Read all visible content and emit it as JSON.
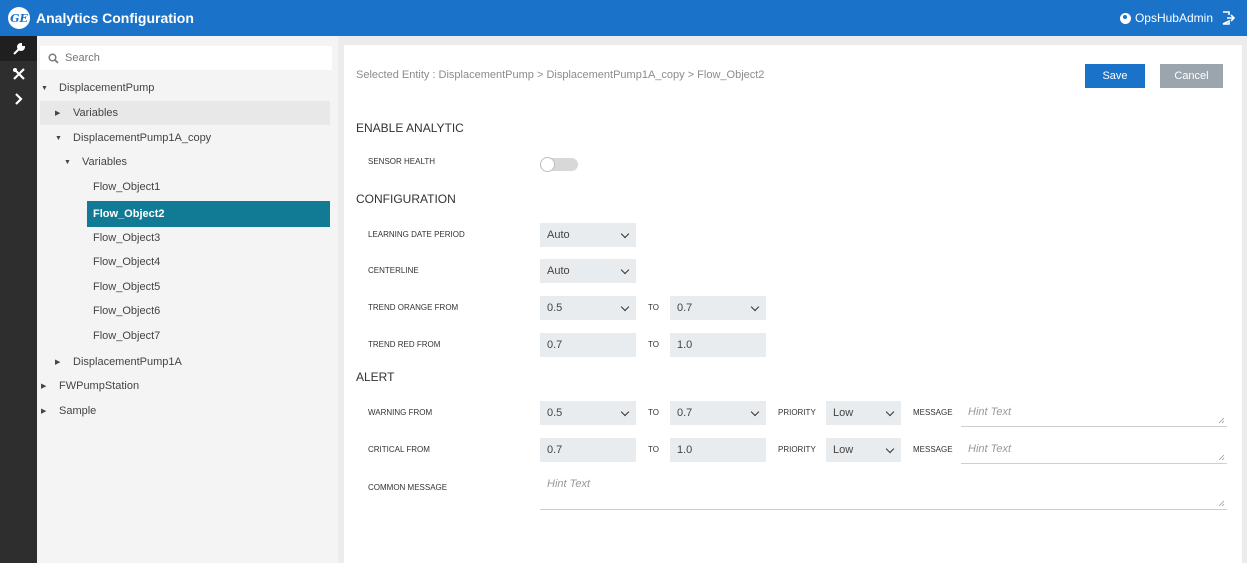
{
  "header": {
    "logo_text": "GE",
    "title": "Analytics Configuration",
    "user": "OpsHubAdmin"
  },
  "rail": {
    "icons": [
      "wrench-icon",
      "tools-icon",
      "chevron-right-icon"
    ]
  },
  "tree": {
    "search_placeholder": "Search",
    "items": [
      {
        "label": "DisplacementPump",
        "caret": "down"
      },
      {
        "label": "Variables",
        "caret": "right"
      },
      {
        "label": "DisplacementPump1A_copy",
        "caret": "down"
      },
      {
        "label": "Variables",
        "caret": "down"
      },
      {
        "label": "Flow_Object1",
        "caret": ""
      },
      {
        "label": "Flow_Object2",
        "caret": ""
      },
      {
        "label": "Flow_Object3",
        "caret": ""
      },
      {
        "label": "Flow_Object4",
        "caret": ""
      },
      {
        "label": "Flow_Object5",
        "caret": ""
      },
      {
        "label": "Flow_Object6",
        "caret": ""
      },
      {
        "label": "Flow_Object7",
        "caret": ""
      },
      {
        "label": "DisplacementPump1A",
        "caret": "right"
      },
      {
        "label": "FWPumpStation",
        "caret": "right"
      },
      {
        "label": "Sample",
        "caret": "right"
      }
    ],
    "selected_index": 5
  },
  "main": {
    "breadcrumb": "Selected Entity : DisplacementPump > DisplacementPump1A_copy > Flow_Object2",
    "save_label": "Save",
    "cancel_label": "Cancel",
    "enable_section": "ENABLE ANALYTIC",
    "sensor_health_label": "SENSOR HEALTH",
    "sensor_health_on": false,
    "config_section": "CONFIGURATION",
    "learning_label": "LEARNING DATE PERIOD",
    "learning_value": "Auto",
    "centerline_label": "CENTERLINE",
    "centerline_value": "Auto",
    "trend_orange_label": "TREND ORANGE FROM",
    "trend_orange_from": "0.5",
    "trend_orange_to": "0.7",
    "trend_red_label": "TREND RED FROM",
    "trend_red_from": "0.7",
    "trend_red_to": "1.0",
    "to_label": "TO",
    "alert_section": "ALERT",
    "warning_label": "WARNING FROM",
    "warning_from": "0.5",
    "warning_to": "0.7",
    "priority_label": "PRIORITY",
    "warning_priority": "Low",
    "message_label": "MESSAGE",
    "hint_text": "Hint Text",
    "critical_label": "CRITICAL FROM",
    "critical_from": "0.7",
    "critical_to": "1.0",
    "critical_priority": "Low",
    "common_message_label": "COMMON MESSAGE"
  }
}
